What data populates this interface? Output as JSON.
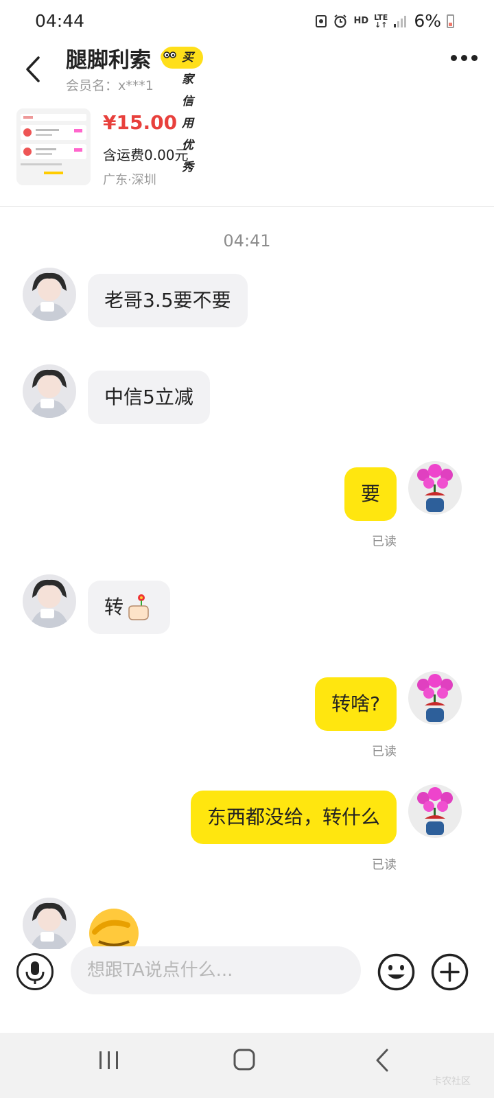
{
  "status_bar": {
    "time": "04:44",
    "hd_label": "HD",
    "network": "LTE",
    "battery": "6%"
  },
  "header": {
    "title": "腿脚利索",
    "badge": "买家信用优秀",
    "member_label": "会员名：x***1"
  },
  "product": {
    "price": "¥15.00",
    "shipping": "含运费0.00元",
    "location": "广东·深圳"
  },
  "chat": {
    "timestamp": "04:41",
    "messages": [
      {
        "side": "in",
        "text": "老哥3.5要不要"
      },
      {
        "side": "in",
        "text": "中信5立减"
      },
      {
        "side": "out",
        "text": "要",
        "read": "已读"
      },
      {
        "side": "in",
        "text": "转"
      },
      {
        "side": "out",
        "text": "转啥?",
        "read": "已读"
      },
      {
        "side": "out",
        "text": "东西都没给，转什么",
        "read": "已读"
      },
      {
        "side": "in",
        "text": ""
      }
    ]
  },
  "composer": {
    "placeholder": "想跟TA说点什么..."
  },
  "watermark": "卡农社区",
  "colors": {
    "accent_yellow": "#ffe60f",
    "price_red": "#e8403c",
    "incoming_bubble": "#f2f2f4"
  }
}
